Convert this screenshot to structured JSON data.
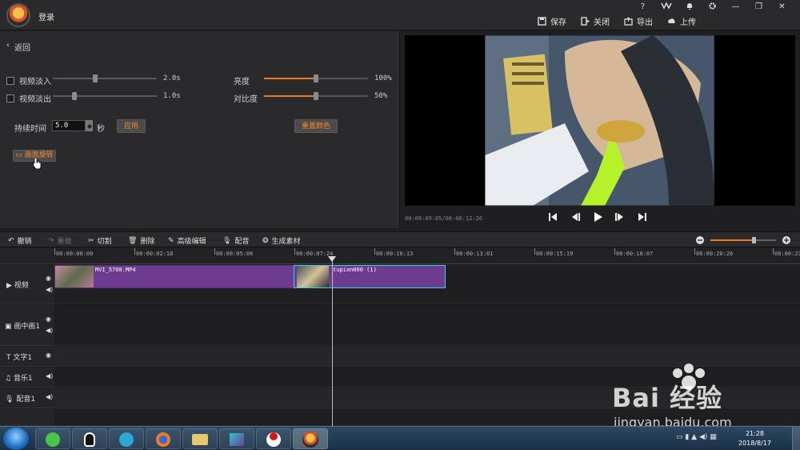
{
  "titlebar": {
    "login": "登录",
    "window_buttons": [
      "?",
      "VIP",
      "bell",
      "gear",
      "—",
      "□",
      "✕"
    ],
    "actions": [
      {
        "label": "保存",
        "icon": "save-icon"
      },
      {
        "label": "关闭",
        "icon": "close-file-icon"
      },
      {
        "label": "导出",
        "icon": "export-icon"
      },
      {
        "label": "上传",
        "icon": "upload-icon"
      }
    ]
  },
  "settings": {
    "back_label": "返回",
    "fade_in": {
      "label": "视频淡入",
      "value": "2.0s",
      "checked": false,
      "level": 0.4
    },
    "fade_out": {
      "label": "视频淡出",
      "value": "1.0s",
      "checked": false,
      "level": 0.2
    },
    "brightness": {
      "label": "亮度",
      "value": "100%",
      "level": 0.5
    },
    "contrast": {
      "label": "对比度",
      "value": "50%",
      "level": 0.5
    },
    "duration": {
      "label": "持续时间",
      "value": "5.0",
      "unit": "秒"
    },
    "apply_label": "应用",
    "reset_color_label": "重置颜色",
    "rotate_label": "画面旋转"
  },
  "preview": {
    "timecode": "00:00:09:05/00:00:12:26"
  },
  "toolbar": {
    "undo": "撤销",
    "redo": "重做",
    "cut": "切割",
    "delete": "删除",
    "advanced": "高级编辑",
    "dub": "配音",
    "generate": "生成素材",
    "zoom_level": 0.75
  },
  "ruler": {
    "ticks": [
      "00:00:00:00",
      "00:00:02:18",
      "00:00:05:06",
      "00:00:07:24",
      "00:00:10:13",
      "00:00:13:01",
      "00:00:15:19",
      "00:00:18:07",
      "00:00:20:26",
      "00:00:23:"
    ]
  },
  "tracks": {
    "video": "视频",
    "pip": "画中画1",
    "text": "文字1",
    "music": "音乐1",
    "voice": "配音1"
  },
  "clips": {
    "clip1": "MVI_5700.MP4",
    "clip2": "tupian000 (1)"
  },
  "taskbar": {
    "time": "21:28",
    "date": "2018/8/17"
  },
  "watermark": {
    "brand": "Bai 经验",
    "url": "jingyan.baidu.com"
  },
  "colors": {
    "accent": "#f07a22",
    "clip": "#6d3b8f",
    "selected": "#32d5e6"
  }
}
